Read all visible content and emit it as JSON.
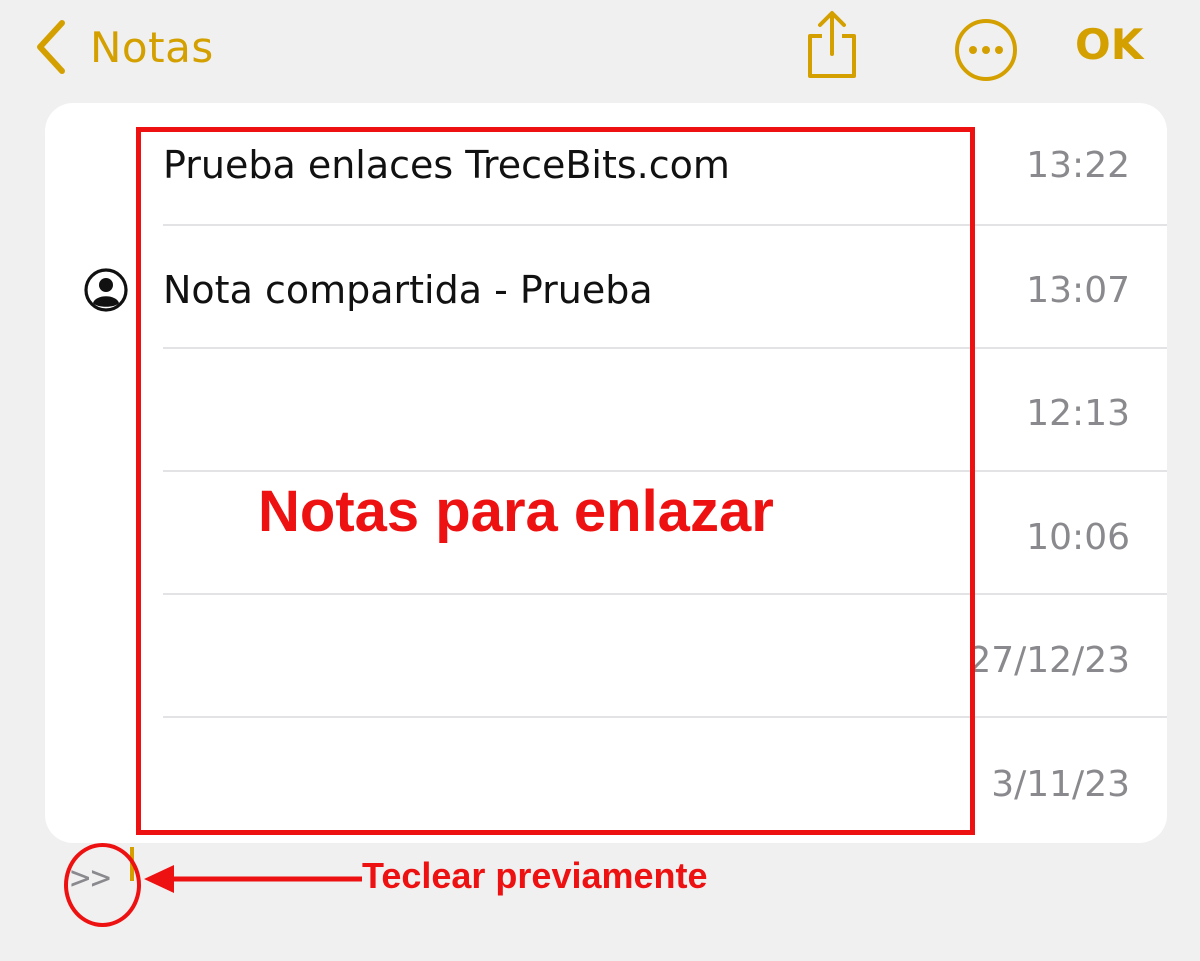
{
  "nav": {
    "back_label": "Notas",
    "done_label": "OK",
    "accent_color": "#d4a000",
    "icons": [
      "chevron-left-icon",
      "share-icon",
      "more-icon"
    ]
  },
  "notes": [
    {
      "title": "Prueba enlaces TreceBits.com",
      "time": "13:22",
      "shared": false
    },
    {
      "title": "Nota compartida - Prueba",
      "time": "13:07",
      "shared": true
    },
    {
      "title": "",
      "time": "12:13",
      "shared": false
    },
    {
      "title": "",
      "time": "10:06",
      "shared": false
    },
    {
      "title": "",
      "time": "27/12/23",
      "shared": false
    },
    {
      "title": "",
      "time": "3/11/23",
      "shared": false
    }
  ],
  "prompt": {
    "label": ">>"
  },
  "annotations": {
    "box_label": "Notas para enlazar",
    "arrow_label": "Teclear previamente",
    "color": "#ee1111"
  }
}
